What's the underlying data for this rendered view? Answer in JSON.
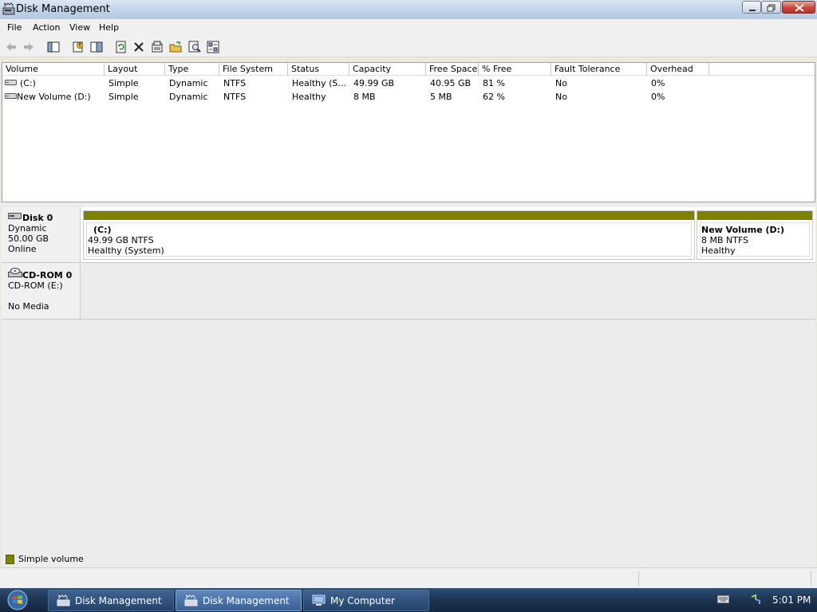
{
  "window": {
    "title": "Disk Management"
  },
  "menu": [
    "File",
    "Action",
    "View",
    "Help"
  ],
  "toolbar": {
    "buttons": [
      "back-icon",
      "forward-icon",
      "show-hide-console-tree-icon",
      "properties-icon",
      "help-icon",
      "refresh-icon",
      "delete-icon",
      "properties-sheet-icon",
      "open-icon",
      "find-icon",
      "settings-icon"
    ]
  },
  "volume_list": {
    "columns": [
      "Volume",
      "Layout",
      "Type",
      "File System",
      "Status",
      "Capacity",
      "Free Space",
      "% Free",
      "Fault Tolerance",
      "Overhead"
    ],
    "rows": [
      [
        "(C:)",
        "Simple",
        "Dynamic",
        "NTFS",
        "Healthy (S...",
        "49.99 GB",
        "40.95 GB",
        "81 %",
        "No",
        "0%"
      ],
      [
        "New Volume (D:)",
        "Simple",
        "Dynamic",
        "NTFS",
        "Healthy",
        "8 MB",
        "5 MB",
        "62 %",
        "No",
        "0%"
      ]
    ]
  },
  "disks": [
    {
      "name": "Disk 0",
      "type": "Dynamic",
      "size": "50.00 GB",
      "status": "Online",
      "volumes": [
        {
          "name": "(C:)",
          "size": "49.99 GB NTFS",
          "status": "Healthy (System)"
        },
        {
          "name": "New Volume  (D:)",
          "size": "8 MB NTFS",
          "status": "Healthy"
        }
      ]
    },
    {
      "name": "CD-ROM 0",
      "type": "CD-ROM (E:)",
      "status": "No Media"
    }
  ],
  "legend": {
    "label": "Simple volume",
    "color": "#808000"
  },
  "taskbar": {
    "tasks": [
      "Disk Management",
      "Disk Management",
      "My Computer"
    ],
    "clock": "5:01 PM"
  }
}
